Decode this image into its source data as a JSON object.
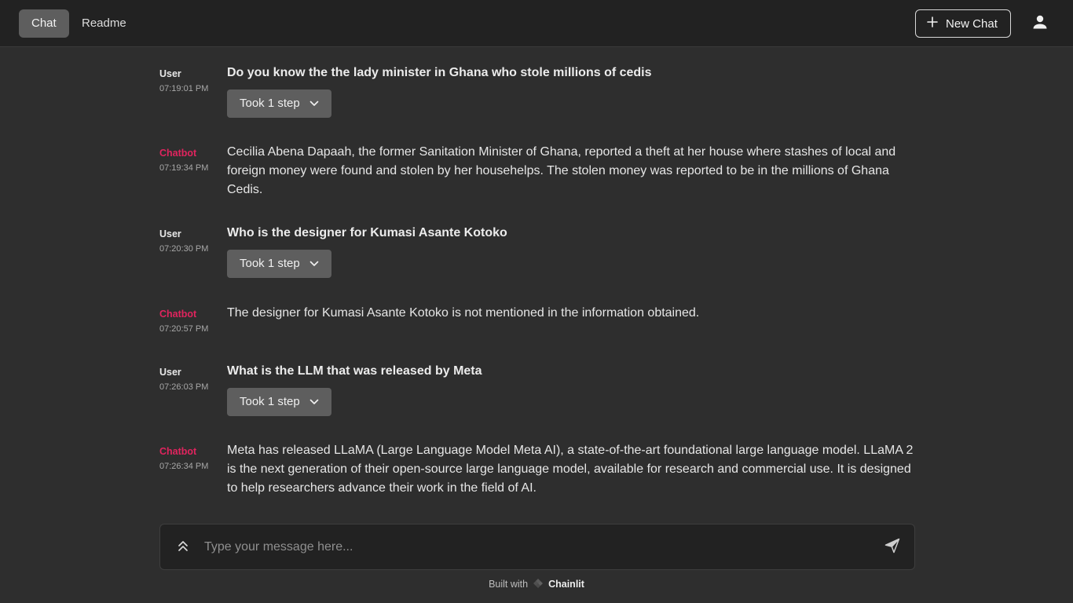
{
  "header": {
    "tabs": [
      {
        "label": "Chat",
        "active": true
      },
      {
        "label": "Readme",
        "active": false
      }
    ],
    "new_chat_label": "New Chat",
    "icons": {
      "new_chat": "plus-icon",
      "account": "user-icon"
    }
  },
  "messages": [
    {
      "author": "User",
      "time": "07:19:01 PM",
      "text": "Do you know the the lady minister in Ghana who stole millions of cedis",
      "step": "Took 1 step"
    },
    {
      "author": "Chatbot",
      "time": "07:19:34 PM",
      "text": "Cecilia Abena Dapaah, the former Sanitation Minister of Ghana, reported a theft at her house where stashes of local and foreign money were found and stolen by her househelps. The stolen money was reported to be in the millions of Ghana Cedis."
    },
    {
      "author": "User",
      "time": "07:20:30 PM",
      "text": "Who is the designer for Kumasi Asante Kotoko",
      "step": "Took 1 step"
    },
    {
      "author": "Chatbot",
      "time": "07:20:57 PM",
      "text": "The designer for Kumasi Asante Kotoko is not mentioned in the information obtained."
    },
    {
      "author": "User",
      "time": "07:26:03 PM",
      "text": "What is the LLM that was released by Meta",
      "step": "Took 1 step"
    },
    {
      "author": "Chatbot",
      "time": "07:26:34 PM",
      "text": "Meta has released LLaMA (Large Language Model Meta AI), a state-of-the-art foundational large language model. LLaMA 2 is the next generation of their open-source large language model, available for research and commercial use. It is designed to help researchers advance their work in the field of AI."
    }
  ],
  "composer": {
    "placeholder": "Type your message here...",
    "value": "",
    "icons": {
      "expand": "chevrons-up-icon",
      "send": "send-icon"
    }
  },
  "footer": {
    "built_with": "Built with",
    "brand": "Chainlit"
  },
  "colors": {
    "background": "#2e2e2e",
    "topbar": "#222222",
    "bot_author": "#e0245e",
    "step_button": "#5e5e5e"
  }
}
